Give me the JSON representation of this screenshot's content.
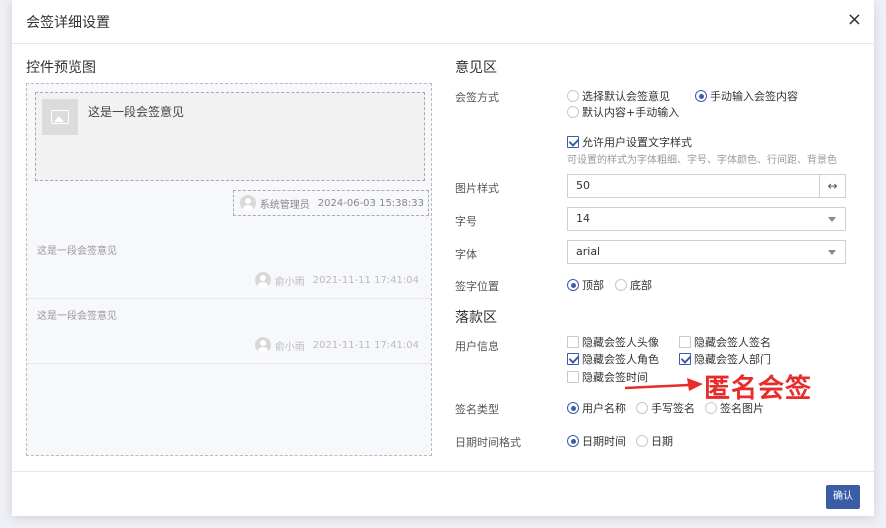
{
  "dialog": {
    "title": "会签详细设置",
    "close_glyph": "×",
    "confirm_label": "确认"
  },
  "preview": {
    "title": "控件预览图",
    "opinion_text": "这是一段会签意见",
    "current": {
      "user": "系统管理员",
      "date": "2024-06-03 15:38:33"
    },
    "entries": [
      {
        "text": "这是一段会签意见",
        "user": "俞小雨",
        "date": "2021-11-11 17:41:04"
      },
      {
        "text": "这是一段会签意见",
        "user": "俞小雨",
        "date": "2021-11-11 17:41:04"
      }
    ]
  },
  "opinion_section": {
    "title": "意见区",
    "mode_label": "会签方式",
    "mode_options": [
      "选择默认会签意见",
      "手动输入会签内容",
      "默认内容+手动输入"
    ],
    "mode_selected": "手动输入会签内容",
    "allow_style_label": "允许用户设置文字样式",
    "allow_style_checked": true,
    "allow_style_hint": "可设置的样式为字体粗细、字号、字体颜色、行间距、背景色",
    "image_style_label": "图片样式",
    "image_style_value": "50",
    "image_style_suffix": "↔",
    "font_size_label": "字号",
    "font_size_value": "14",
    "font_family_label": "字体",
    "font_family_value": "arial",
    "sign_position_label": "签字位置",
    "sign_position_options": [
      "顶部",
      "底部"
    ],
    "sign_position_selected": "顶部"
  },
  "signature_section": {
    "title": "落款区",
    "user_info_label": "用户信息",
    "user_info_options": [
      {
        "label": "隐藏会签人头像",
        "checked": false
      },
      {
        "label": "隐藏会签人签名",
        "checked": false
      },
      {
        "label": "隐藏会签人角色",
        "checked": true
      },
      {
        "label": "隐藏会签人部门",
        "checked": true
      },
      {
        "label": "隐藏会签时间",
        "checked": false
      }
    ],
    "sign_type_label": "签名类型",
    "sign_type_options": [
      "用户名称",
      "手写签名",
      "签名图片"
    ],
    "sign_type_selected": "用户名称",
    "datetime_label": "日期时间格式",
    "datetime_options": [
      "日期时间",
      "日期"
    ],
    "datetime_selected": "日期时间"
  },
  "annotation": {
    "text": "匿名会签",
    "color": "#e82b2b"
  },
  "colors": {
    "accent": "#3d5ca8"
  }
}
